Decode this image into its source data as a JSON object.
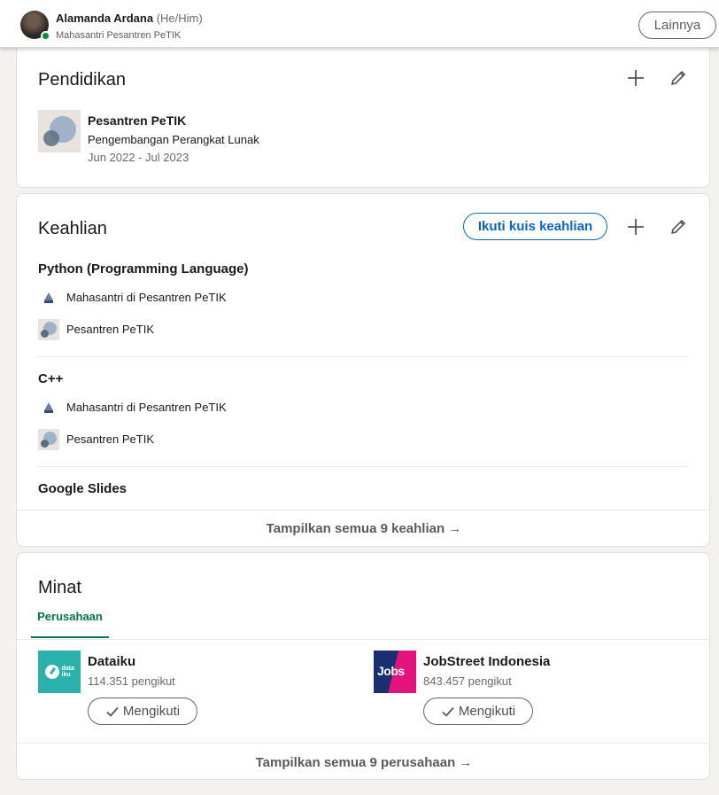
{
  "header": {
    "name": "Alamanda Ardana",
    "pronouns": "(He/Him)",
    "headline": "Mahasantri Pesantren PeTIK",
    "more_label": "Lainnya"
  },
  "education": {
    "title": "Pendidikan",
    "items": [
      {
        "school": "Pesantren PeTIK",
        "field": "Pengembangan Perangkat Lunak",
        "dates": "Jun 2022 - Jul 2023"
      }
    ]
  },
  "skills": {
    "title": "Keahlian",
    "quiz_label": "Ikuti kuis keahlian",
    "items": [
      {
        "name": "Python (Programming Language)",
        "endorsements": [
          {
            "icon": "petik-small-logo",
            "text": "Mahasantri di Pesantren PeTIK"
          },
          {
            "icon": "pesantren-petik-logo",
            "text": "Pesantren PeTIK"
          }
        ]
      },
      {
        "name": "C++",
        "endorsements": [
          {
            "icon": "petik-small-logo",
            "text": "Mahasantri di Pesantren PeTIK"
          },
          {
            "icon": "pesantren-petik-logo",
            "text": "Pesantren PeTIK"
          }
        ]
      },
      {
        "name": "Google Slides"
      }
    ],
    "show_all": "Tampilkan semua 9 keahlian →"
  },
  "interests": {
    "title": "Minat",
    "tabs": [
      {
        "label": "Perusahaan",
        "active": true
      }
    ],
    "companies": [
      {
        "name": "Dataiku",
        "followers": "114.351 pengikut",
        "follow_label": "Mengikuti",
        "logo_text": "data iku"
      },
      {
        "name": "JobStreet Indonesia",
        "followers": "843.457 pengikut",
        "follow_label": "Mengikuti",
        "logo_text": "Jobs"
      }
    ],
    "show_all": "Tampilkan semua 9 perusahaan →"
  },
  "colors": {
    "brand_blue": "#0a66c2",
    "active_green": "#057642",
    "background": "#f3f2ef",
    "dataiku_teal": "#2ab1ac",
    "jobstreet_navy": "#1b2e6f",
    "jobstreet_pink": "#e3137e"
  }
}
